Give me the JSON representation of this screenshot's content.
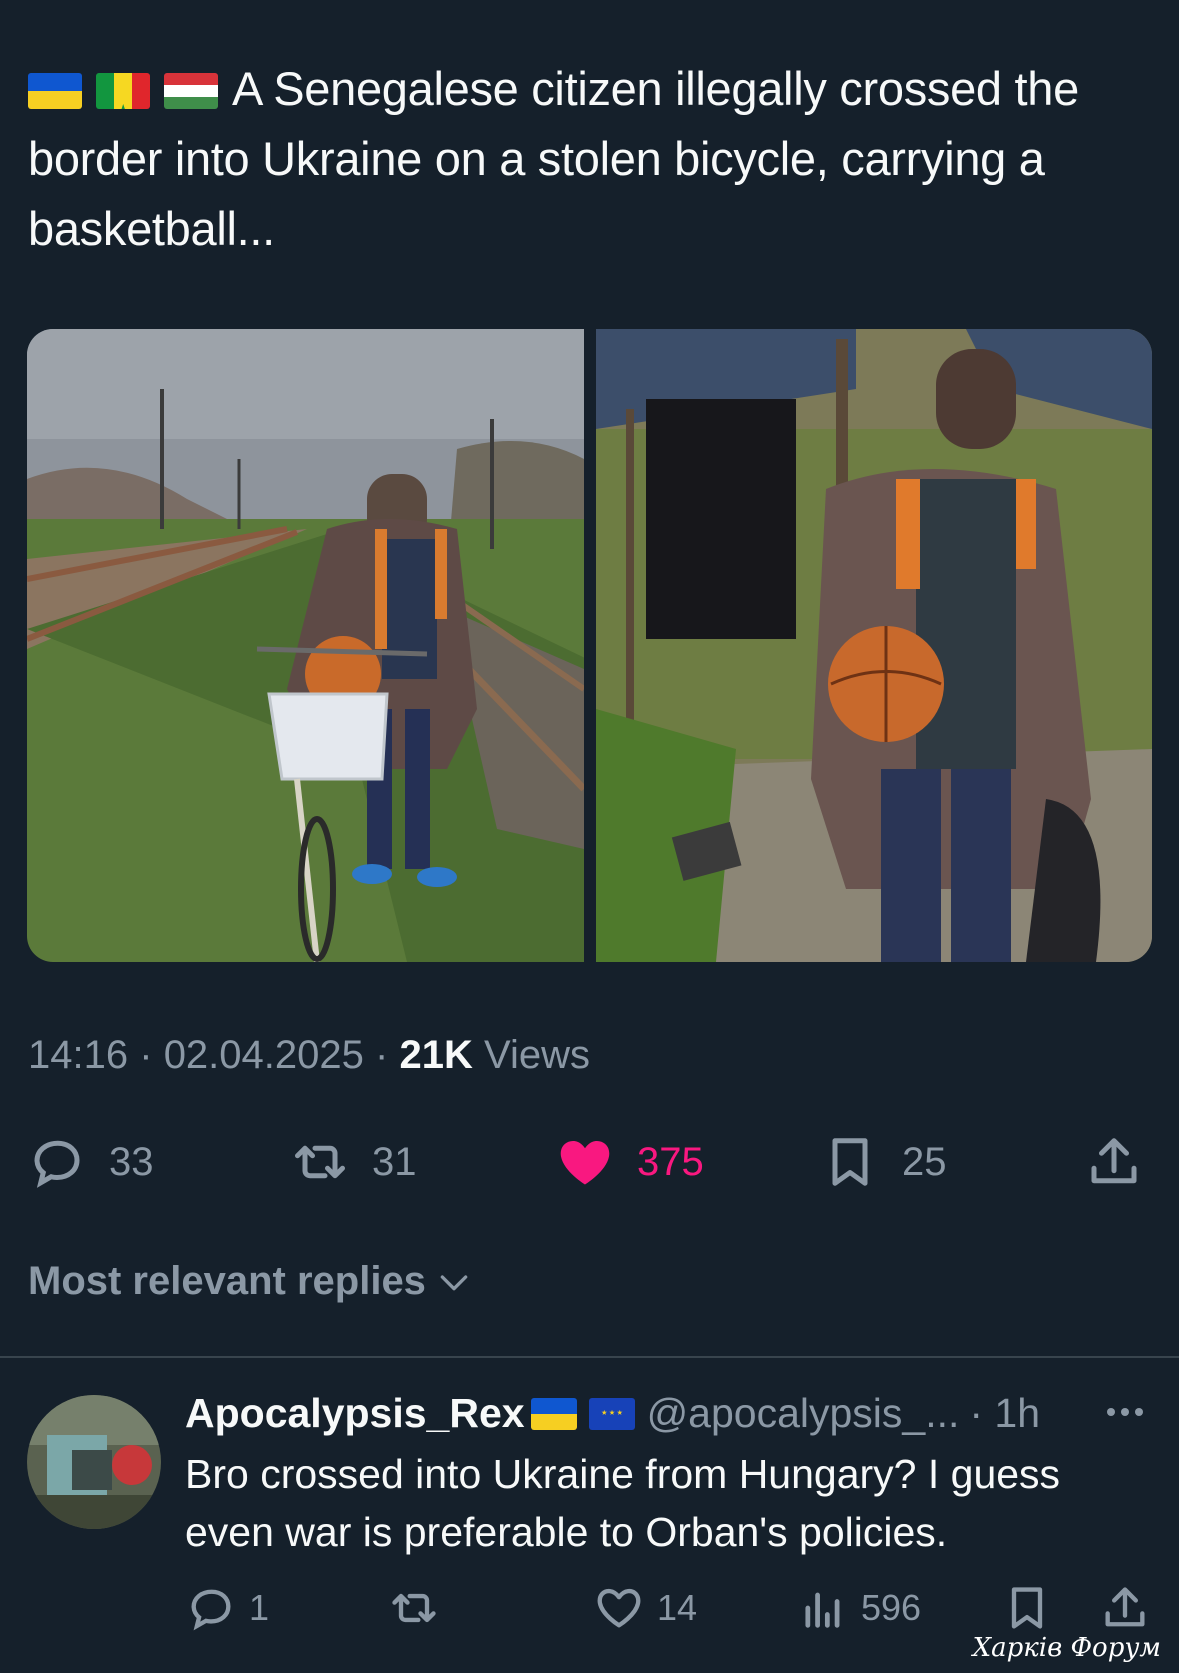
{
  "tweet": {
    "flags": [
      "ukraine-flag",
      "senegal-flag",
      "hungary-flag"
    ],
    "text": "A Senegalese citizen illegally crossed the border into Ukraine on a stolen bicycle, carrying a basketball...",
    "time": "14:16",
    "separator": "·",
    "date": "02.04.2025",
    "views_count": "21K",
    "views_label": "Views",
    "stats": {
      "replies": "33",
      "reposts": "31",
      "likes": "375",
      "bookmarks": "25"
    }
  },
  "replies_sort_label": "Most relevant replies",
  "reply": {
    "name": "Apocalypsis_Rex",
    "flags": [
      "ukraine-flag",
      "eu-flag"
    ],
    "handle": "@apocalypsis_...",
    "age": "· 1h",
    "text": "Bro crossed into Ukraine from Hungary? I guess even war is preferable to Orban's policies.",
    "stats": {
      "replies": "1",
      "likes": "14",
      "views": "596"
    }
  },
  "watermark": "Харків Форум",
  "colors": {
    "background": "#15202b",
    "text": "#f7f9f9",
    "muted": "#8b98a5",
    "like": "#f91880",
    "divider": "#38444d"
  }
}
